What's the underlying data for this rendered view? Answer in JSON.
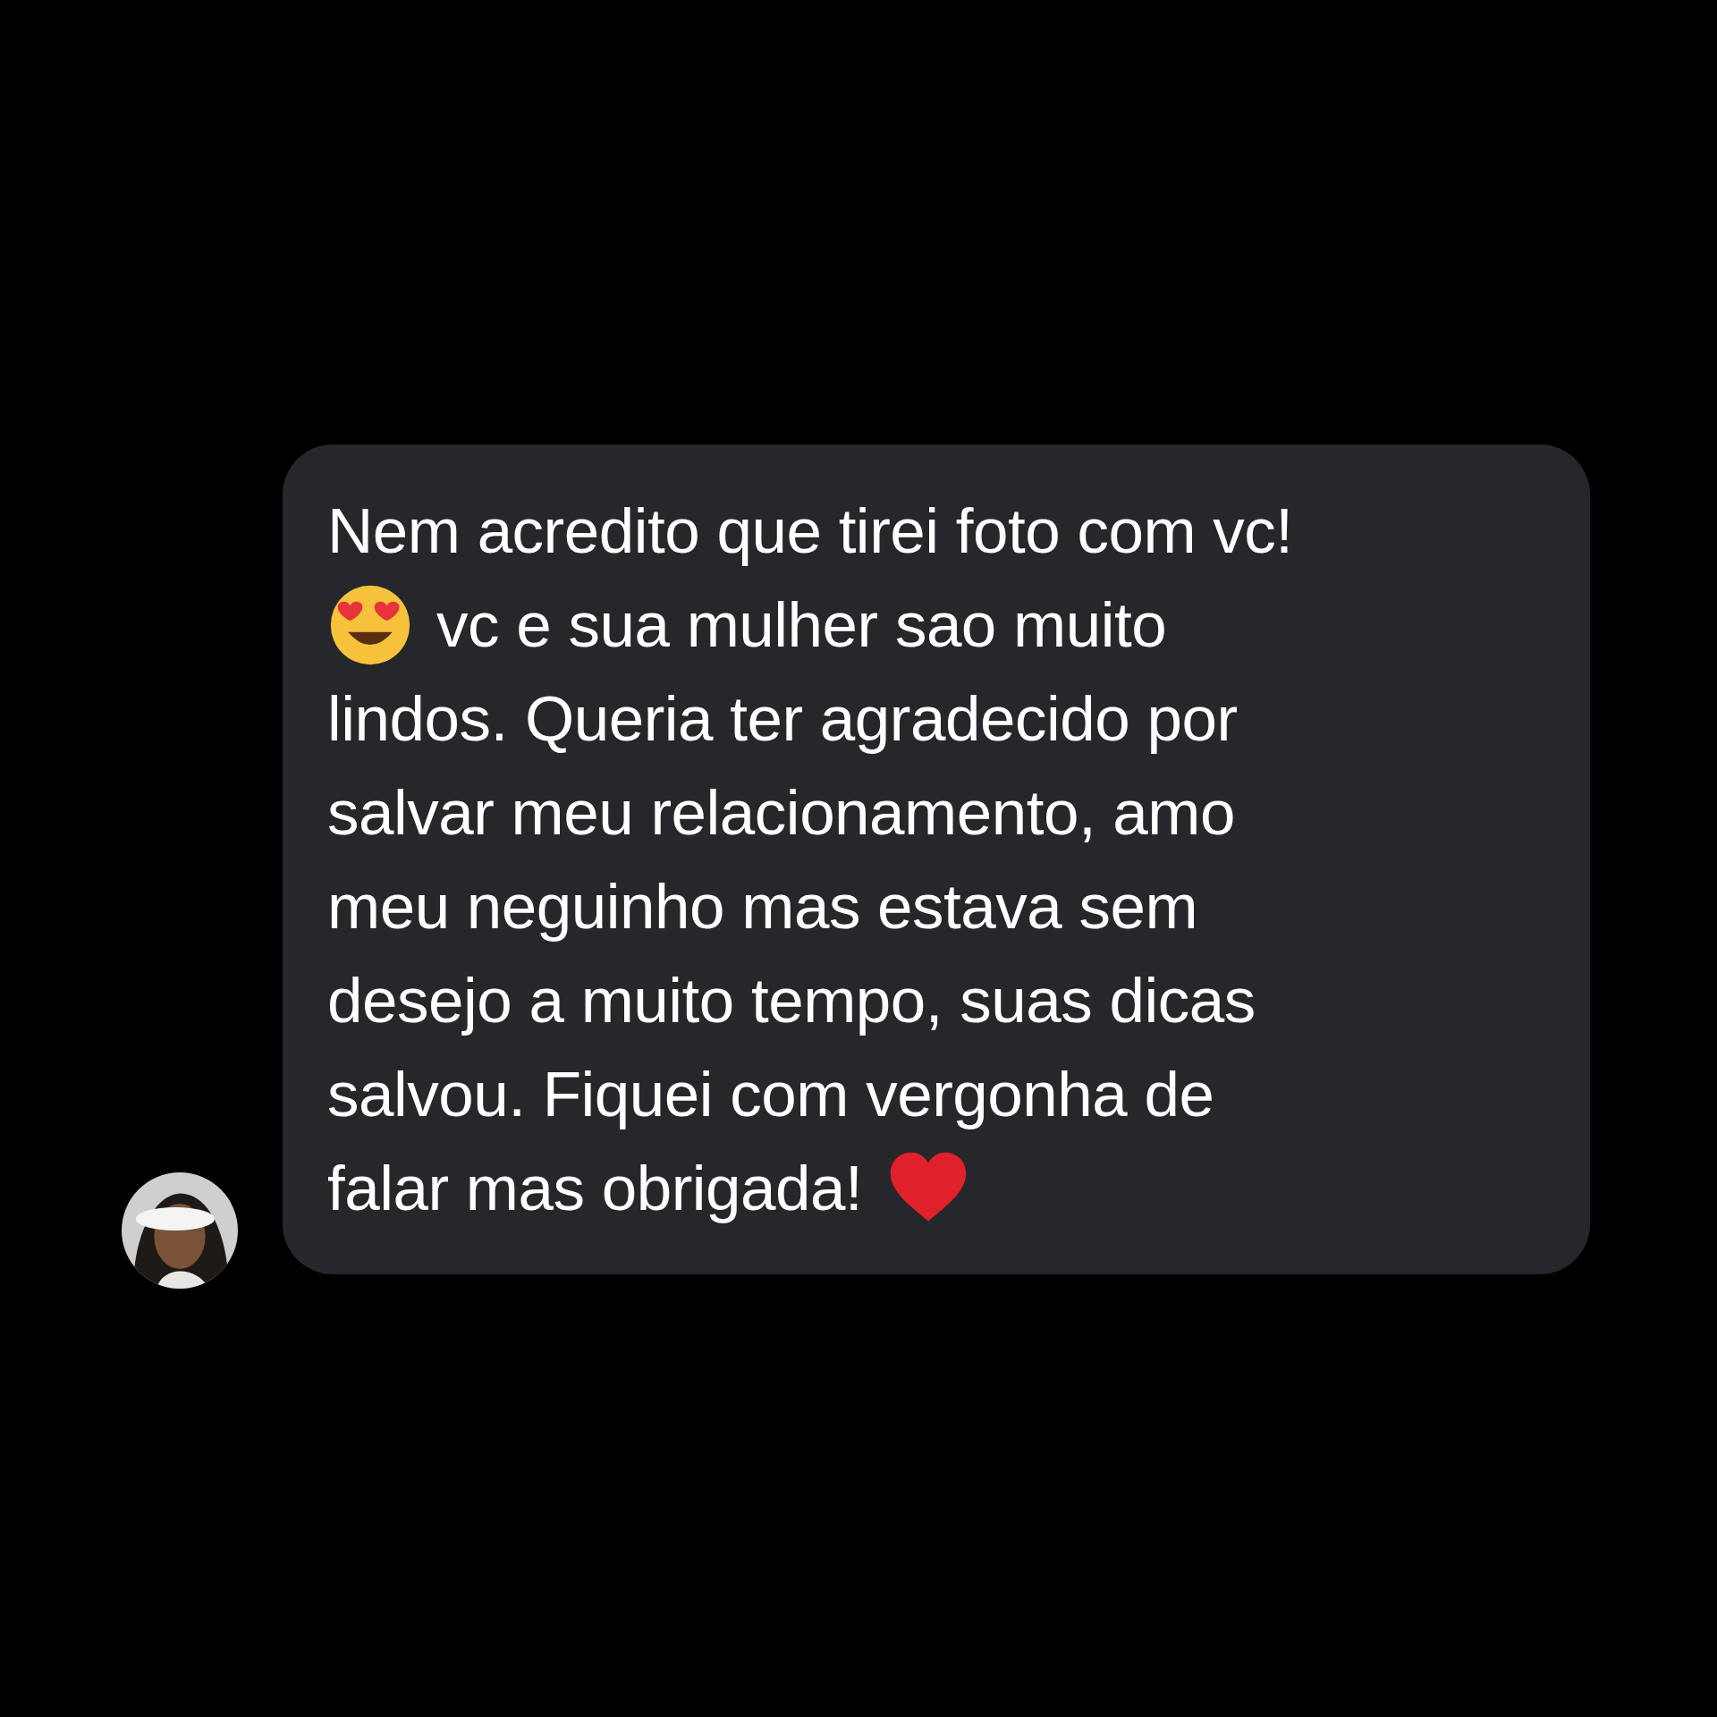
{
  "message": {
    "lines": [
      {
        "parts": [
          {
            "kind": "text",
            "text": "Nem acredito que tirei foto com vc!"
          }
        ]
      },
      {
        "parts": [
          {
            "kind": "heart-eyes"
          },
          {
            "kind": "text",
            "text": "vc e sua mulher sao muito"
          }
        ]
      },
      {
        "parts": [
          {
            "kind": "text",
            "text": "lindos. Queria ter agradecido por"
          }
        ]
      },
      {
        "parts": [
          {
            "kind": "text",
            "text": "salvar meu relacionamento, amo"
          }
        ]
      },
      {
        "parts": [
          {
            "kind": "text",
            "text": "meu neguinho mas estava sem"
          }
        ]
      },
      {
        "parts": [
          {
            "kind": "text",
            "text": "desejo a muito tempo, suas dicas"
          }
        ]
      },
      {
        "parts": [
          {
            "kind": "text",
            "text": "salvou. Fiquei com vergonha de"
          }
        ]
      },
      {
        "parts": [
          {
            "kind": "text",
            "text": "falar mas obrigada!"
          },
          {
            "kind": "heart"
          }
        ]
      }
    ]
  }
}
